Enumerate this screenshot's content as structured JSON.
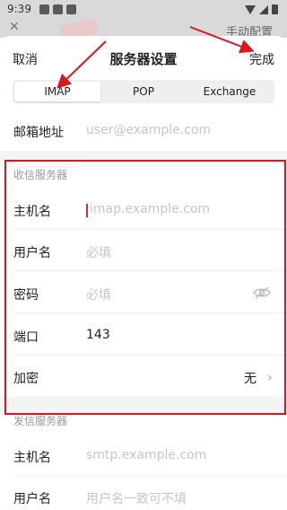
{
  "status": {
    "time": "9:39"
  },
  "background": {
    "title": "手动配置"
  },
  "nav": {
    "cancel": "取消",
    "title": "服务器设置",
    "done": "完成"
  },
  "tabs": [
    {
      "label": "IMAP",
      "active": true
    },
    {
      "label": "POP",
      "active": false
    },
    {
      "label": "Exchange",
      "active": false
    }
  ],
  "email": {
    "label": "邮箱地址",
    "placeholder": "user@example.com"
  },
  "incoming": {
    "title": "收信服务器",
    "host": {
      "label": "主机名",
      "placeholder": "imap.example.com"
    },
    "username": {
      "label": "用户名",
      "placeholder": "必填"
    },
    "password": {
      "label": "密码",
      "placeholder": "必填"
    },
    "port": {
      "label": "端口",
      "value": "143"
    },
    "encryption": {
      "label": "加密",
      "value": "无"
    }
  },
  "outgoing": {
    "title": "发信服务器",
    "host": {
      "label": "主机名",
      "placeholder": "smtp.example.com"
    },
    "username": {
      "label": "用户名",
      "placeholder": "用户名一致可不填"
    }
  },
  "colors": {
    "annotation": "#e0141e",
    "placeholder": "#c6c6c6",
    "accent_caret": "#d32f2f"
  }
}
